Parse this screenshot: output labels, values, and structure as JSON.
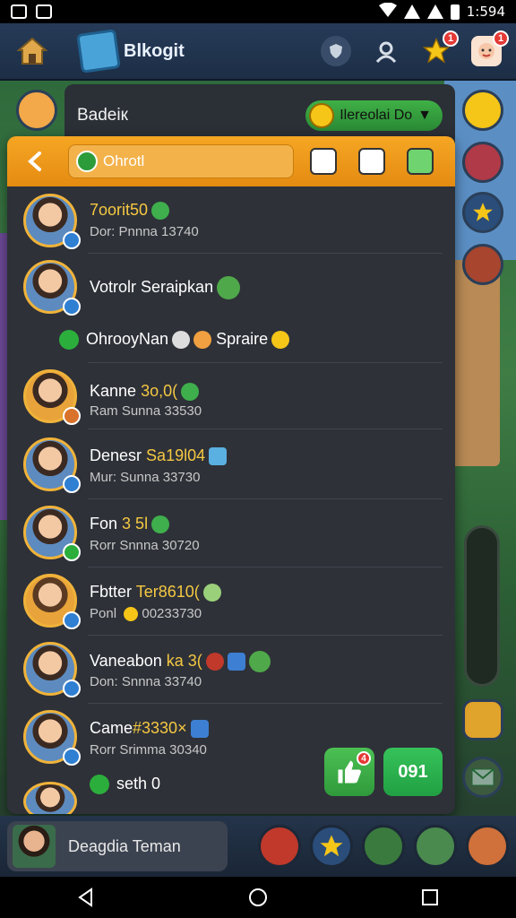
{
  "status_bar": {
    "time": "1:594"
  },
  "top_bar": {
    "title": "Blkogit",
    "star_badge": "1",
    "profile_badge": "1"
  },
  "back_panel": {
    "title": "Badeiк",
    "dropdown_label": "Ilereolai Do"
  },
  "panel": {
    "search_text": "Ohrotl"
  },
  "friends": [
    {
      "name": "7oorit50",
      "sub": "Dor: Pnnna 13740"
    },
    {
      "name": "Votrolr Seraipkan",
      "sub": ""
    },
    {
      "name": "OhrooyNan",
      "sub": "",
      "extra": "Spraire"
    },
    {
      "name": "Kanne",
      "name_hl": "3o,0(",
      "sub": "Ram Sunna 33530"
    },
    {
      "name": "Denesr",
      "name_hl": "Sa19l04",
      "sub": "Mur: Sunna 33730"
    },
    {
      "name": "Fon",
      "name_hl": "3 5l",
      "sub": "Rorr Snnna 30720"
    },
    {
      "name": "Fbtter",
      "name_hl": "Ter8610(",
      "sub": "Ponl",
      "sub_hl": "00233730"
    },
    {
      "name": "Vaneabon",
      "name_hl": "ka 3(",
      "sub": "Don: Snnna 33740"
    },
    {
      "name": "Came",
      "name_hl": "#3330×",
      "sub": "Rorr Srimma 30340"
    },
    {
      "name": "",
      "sub": "",
      "extra": "seth 0"
    }
  ],
  "count_button": "091",
  "like_badge": "4",
  "dock": {
    "friend_chip": "Deagdia Teman"
  },
  "colors": {
    "accent_orange": "#f6a623",
    "accent_green": "#2cae3c",
    "panel_dark": "#2e3138",
    "highlight_yellow": "#f5c842"
  }
}
